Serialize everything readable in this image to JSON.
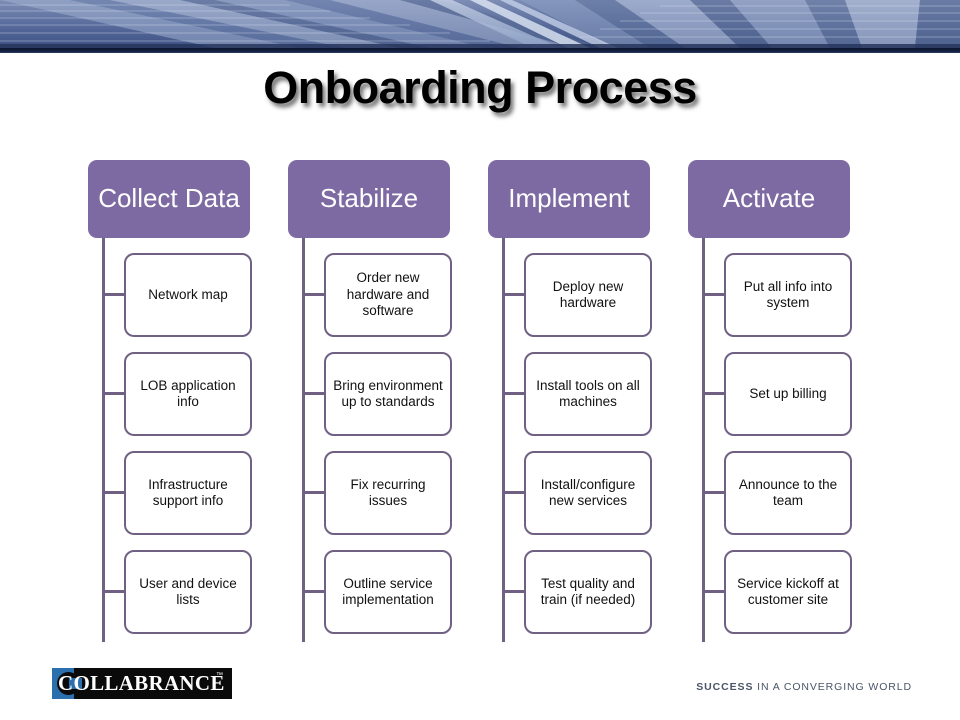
{
  "slide": {
    "title": "Onboarding Process",
    "accent_purple": "#7d6aa3",
    "border_purple": "#6f6084",
    "banner_blue": "#5a6f9e",
    "logo_blue": "#2b6fad"
  },
  "columns": [
    {
      "header": "Collect Data",
      "items": [
        "Network map",
        "LOB application info",
        "Infrastructure support info",
        "User and device lists"
      ]
    },
    {
      "header": "Stabilize",
      "items": [
        "Order new hardware and software",
        "Bring environment up to standards",
        "Fix recurring issues",
        "Outline service implementation"
      ]
    },
    {
      "header": "Implement",
      "items": [
        "Deploy new hardware",
        "Install tools on all machines",
        "Install/configure new services",
        "Test quality and train (if needed)"
      ]
    },
    {
      "header": "Activate",
      "items": [
        "Put all info into system",
        "Set up billing",
        "Announce to the team",
        "Service kickoff at customer site"
      ]
    }
  ],
  "footer": {
    "logo_text": "COLLABRANCE",
    "logo_tm": "™",
    "tagline_bold": "SUCCESS",
    "tagline_rest": " IN A CONVERGING WORLD"
  }
}
